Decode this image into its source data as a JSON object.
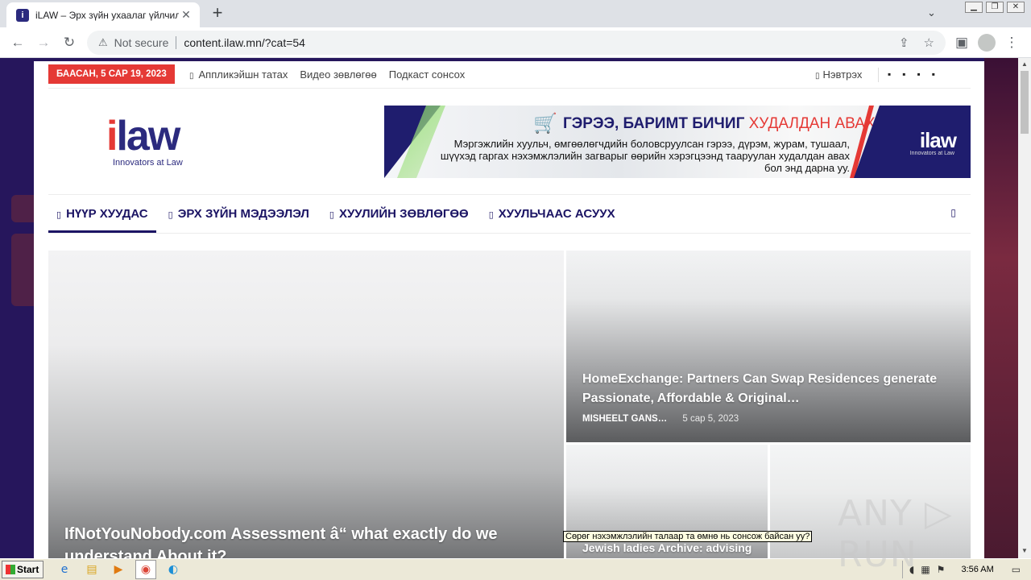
{
  "browser": {
    "tab_title": "iLAW – Эрх зүйн ухаалаг үйлчилгээ",
    "tab_favicon": "i",
    "address_warning": "Not secure",
    "url": "content.ilaw.mn/?cat=54"
  },
  "site": {
    "date_badge": "БААСАН, 5 САР 19, 2023",
    "top_links": [
      "Аппликэйшн татах",
      "Видео зөвлөгөө",
      "Подкаст сонсох"
    ],
    "login_label": "Нэвтрэх",
    "social_icons": [
      "facebook-icon",
      "twitter-icon",
      "instagram-icon",
      "youtube-icon"
    ],
    "logo": {
      "word_i": "i",
      "word_rest": "law",
      "tagline": "Innovators at Law"
    },
    "banner": {
      "title_main": "ГЭРЭЭ, БАРИМТ БИЧИГ ",
      "title_accent": "ХУДАЛДАН АВАХ",
      "description": "Мэргэжлийн хуульч, өмгөөлөгчдийн боловсруулсан гэрээ, дүрэм, журам, тушаал, шүүхэд гаргах нэхэмжлэлийн загварыг өөрийн хэрэгцээнд тааруулан худалдан авах бол энд дарна уу.",
      "logo_word": "ilaw",
      "logo_tagline": "Innovators at Law"
    },
    "main_nav": [
      "НҮҮР ХУУДАС",
      "ЭРХ ЗҮЙН МЭДЭЭЛЭЛ",
      "ХУУЛИЙН ЗӨВЛӨГӨӨ",
      "ХУУЛЬЧААС АСУУХ"
    ],
    "articles": {
      "big_title": "IfNotYouNobody.com Assessment â“ what exactly do we understand About it?",
      "wide_title": "HomeExchange: Partners Can Swap Residences generate Passionate, Affordable & Original…",
      "wide_author": "MISHEELT GANS…",
      "wide_date": "5 сар 5, 2023",
      "small1_title": "Jewish ladies Archive: advising"
    },
    "tooltip": "Сөрөг нэхэмжлэлийн талаар та өмнө нь сонсож байсан уу?"
  },
  "watermark": "ANY ▷ RUN",
  "taskbar": {
    "start_label": "Start",
    "clock": "3:56 AM"
  },
  "colors": {
    "brand_navy": "#1b1464",
    "accent_red": "#e53935",
    "page_bg": "#26165c"
  }
}
